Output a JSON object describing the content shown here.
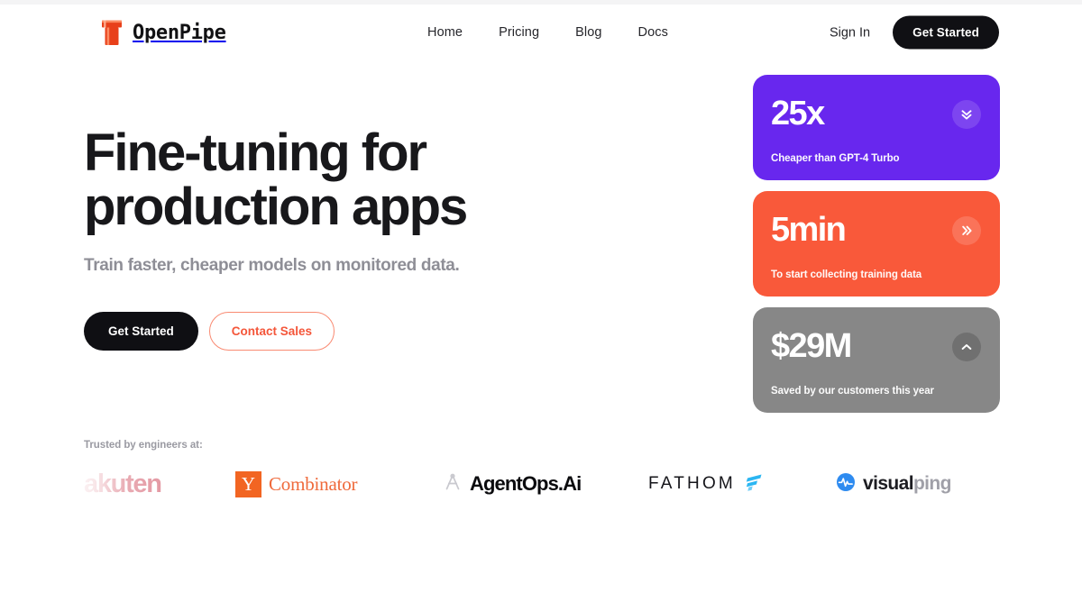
{
  "brand": {
    "name": "OpenPipe",
    "icon": "pipe-icon"
  },
  "nav": {
    "links": [
      {
        "label": "Home"
      },
      {
        "label": "Pricing"
      },
      {
        "label": "Blog"
      },
      {
        "label": "Docs"
      }
    ],
    "sign_in_label": "Sign In",
    "get_started_label": "Get Started"
  },
  "hero": {
    "title_line1": "Fine-tuning for",
    "title_line2": "production apps",
    "subtitle": "Train faster, cheaper models on monitored data.",
    "primary_cta": "Get Started",
    "secondary_cta": "Contact Sales"
  },
  "stat_cards": [
    {
      "value": "25x",
      "label": "Cheaper than GPT-4 Turbo",
      "icon": "double-chevron-down-icon",
      "color": "#6827ee"
    },
    {
      "value": "5min",
      "label": "To start collecting training data",
      "icon": "double-chevron-right-icon",
      "color": "#f9593a"
    },
    {
      "value": "$29M",
      "label": "Saved by our customers this year",
      "icon": "chevron-up-icon",
      "color": "#878787"
    }
  ],
  "trusted": {
    "label": "Trusted by engineers at:",
    "logos": [
      {
        "name": "Rakuten",
        "text": "akuten"
      },
      {
        "name": "Y Combinator",
        "mark": "Y",
        "text": "Combinator"
      },
      {
        "name": "AgentOps.Ai",
        "text": "AgentOps.Ai"
      },
      {
        "name": "Fathom",
        "text": "FATHOM"
      },
      {
        "name": "visualping",
        "text_dark": "visual",
        "text_gray": "ping"
      }
    ]
  },
  "colors": {
    "accent_orange": "#f9593a",
    "accent_purple": "#6827ee",
    "accent_gray": "#878787",
    "dark": "#101014",
    "page_background": "#ffffff"
  }
}
